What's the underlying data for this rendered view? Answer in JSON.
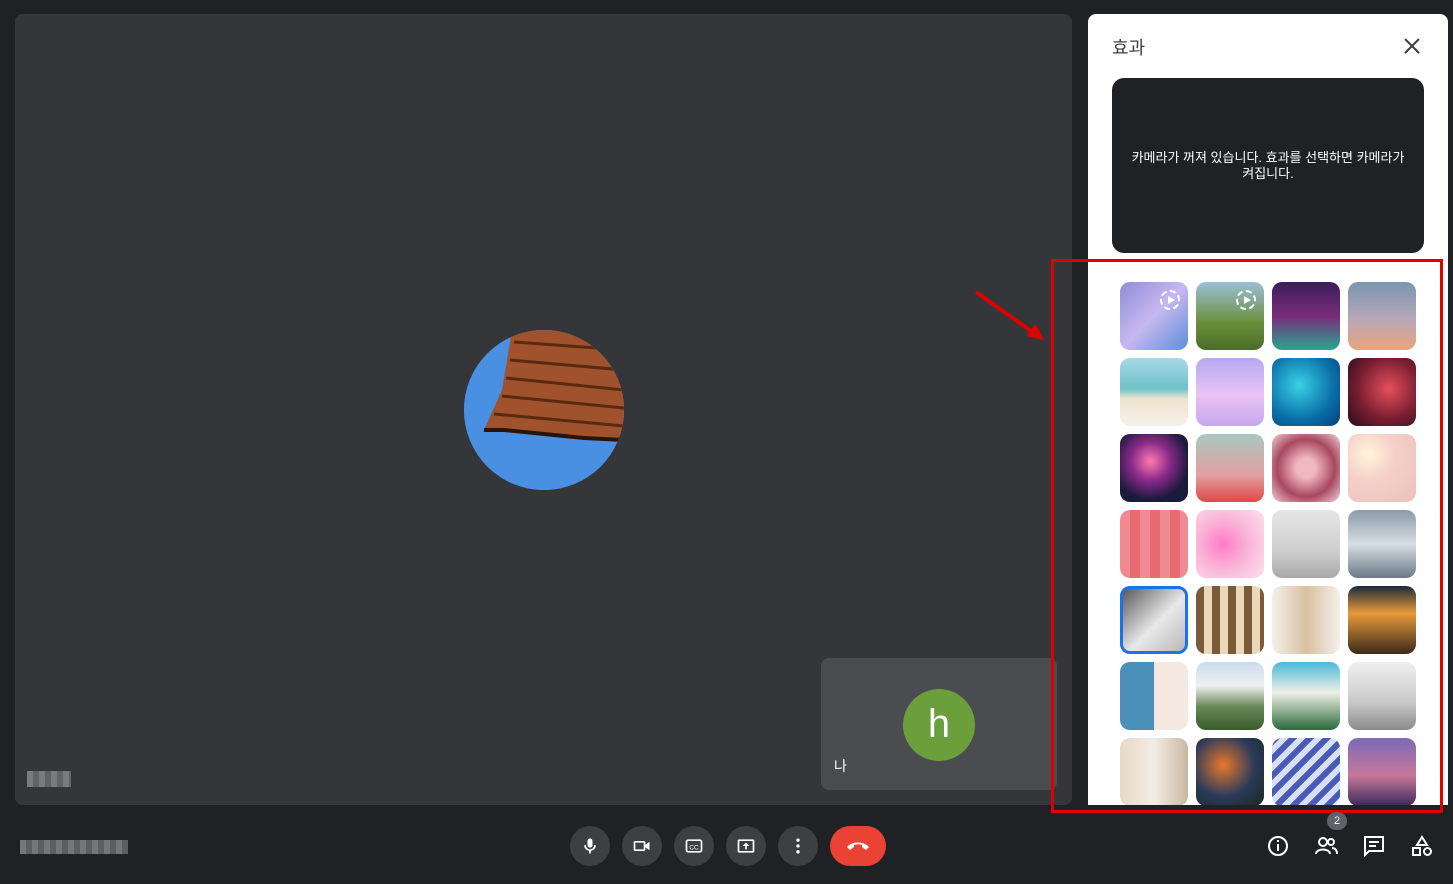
{
  "panel": {
    "title": "효과",
    "preview_message": "카메라가 꺼져 있습니다. 효과를 선택하면 카메라가 켜집니다."
  },
  "self_tile": {
    "avatar_initial": "h",
    "label": "나"
  },
  "participants_count": "2",
  "colors": {
    "selected_border": "#1a73e8",
    "end_call": "#ea4335",
    "highlight": "#e00000"
  },
  "effects": [
    {
      "name": "effect-classroom",
      "bg": "linear-gradient(135deg,#8e8cd8,#c7b8f0 50%,#5b8fd8)",
      "animated": true
    },
    {
      "name": "effect-forest",
      "bg": "linear-gradient(180deg,#9bbfd8,#6a8f3b 60%,#4b6b2a)",
      "animated": true
    },
    {
      "name": "effect-party",
      "bg": "linear-gradient(180deg,#3a1e5c,#7a2b7a 50%,#2aa58f)",
      "animated": false
    },
    {
      "name": "effect-sunset-sky",
      "bg": "linear-gradient(180deg,#7a95b0,#b8a7b8 55%,#e8a67a)",
      "animated": false
    },
    {
      "name": "effect-beach",
      "bg": "linear-gradient(180deg,#a8d8e8,#6fc2c8 45%,#efe3d0 60%,#f5f1ea)",
      "animated": false
    },
    {
      "name": "effect-pink-clouds",
      "bg": "linear-gradient(180deg,#b6a9f0,#e9c2f4 55%,#c5a7ee)",
      "animated": false
    },
    {
      "name": "effect-underwater",
      "bg": "radial-gradient(circle at 40% 40%,#3ad1e8,#0a6fa8 60%,#0a3f7a)",
      "animated": false
    },
    {
      "name": "effect-galaxy",
      "bg": "radial-gradient(circle at 60% 45%,#e6505a,#7a1e32 55%,#2a0c1a)",
      "animated": false
    },
    {
      "name": "effect-fireworks",
      "bg": "radial-gradient(circle at 45% 40%,#ff7ab0,#8a2a8a 35%,#1a1a3c 70%)",
      "animated": false
    },
    {
      "name": "effect-flowers-sky",
      "bg": "linear-gradient(180deg,#a8c8c0,#e0a0a0 60%,#e04848)",
      "animated": false
    },
    {
      "name": "effect-roses",
      "bg": "radial-gradient(circle,#f0b8c0 20%,#a84860 60%,#f0d0d8)",
      "animated": false
    },
    {
      "name": "effect-pink-bokeh",
      "bg": "radial-gradient(circle at 30% 30%,#fff0d8 5%,#f4cfc8 40%,#eac2bd)",
      "animated": false
    },
    {
      "name": "effect-pink-pattern",
      "bg": "repeating-linear-gradient(90deg,#f08a90 0 10px,#e86a72 10px 20px)",
      "animated": false
    },
    {
      "name": "effect-petals",
      "bg": "radial-gradient(circle at 40% 50%,#ff7ac8,#f8b8d8 50%,#fde0ee)",
      "animated": false
    },
    {
      "name": "effect-gallery-wall",
      "bg": "linear-gradient(180deg,#e6e6e6,#cfcfcf 60%,#a8a8a8)",
      "animated": false
    },
    {
      "name": "effect-glass-ceiling",
      "bg": "linear-gradient(180deg,#8a9aa8,#d8dee4 50%,#6a7a88)",
      "animated": false
    },
    {
      "name": "effect-bright-room",
      "bg": "linear-gradient(135deg,#5a5a5a,#e8e8e8 55%,#b8b8b8)",
      "animated": false
    },
    {
      "name": "effect-bookshelf",
      "bg": "repeating-linear-gradient(90deg,#7a5a3a 0 8px,#e8d8b8 8px 16px)",
      "animated": false
    },
    {
      "name": "effect-shelves",
      "bg": "linear-gradient(90deg,#f4f0ea,#d8c0a0 50%,#f4f0ea)",
      "animated": false
    },
    {
      "name": "effect-cafe",
      "bg": "linear-gradient(180deg,#1a2a3a,#e89a3a 40%,#3a2a1a)",
      "animated": false
    },
    {
      "name": "effect-seaside-window",
      "bg": "linear-gradient(90deg,#4a90b8 50%,#f4e8e0 50%)",
      "animated": false
    },
    {
      "name": "effect-mountains",
      "bg": "linear-gradient(180deg,#c8dcec,#f0f0f0 35%,#6a8a5a 65%,#3a5a2a)",
      "animated": false
    },
    {
      "name": "effect-tropical-beach",
      "bg": "linear-gradient(180deg,#4ab8d8,#f0f0e8 45%,#2a6a3a)",
      "animated": false
    },
    {
      "name": "effect-horses",
      "bg": "linear-gradient(180deg,#f0f0f0,#c8c8c8 60%,#8a8a8a)",
      "animated": false
    },
    {
      "name": "effect-kitchen",
      "bg": "linear-gradient(90deg,#e8d8c8,#f4ece4 50%,#c8b8a0)",
      "animated": false
    },
    {
      "name": "effect-autumn-leaves",
      "bg": "radial-gradient(circle at 40% 40%,#e8782a,#2a3a5a 55%,#1a2a1a)",
      "animated": false
    },
    {
      "name": "effect-ferns",
      "bg": "repeating-linear-gradient(135deg,#4a5ab8 0 6px,#d8e0f8 6px 12px)",
      "animated": false
    },
    {
      "name": "effect-city-night",
      "bg": "linear-gradient(180deg,#7a6ab8,#c8789a 55%,#3a2a5a)",
      "animated": false
    }
  ]
}
